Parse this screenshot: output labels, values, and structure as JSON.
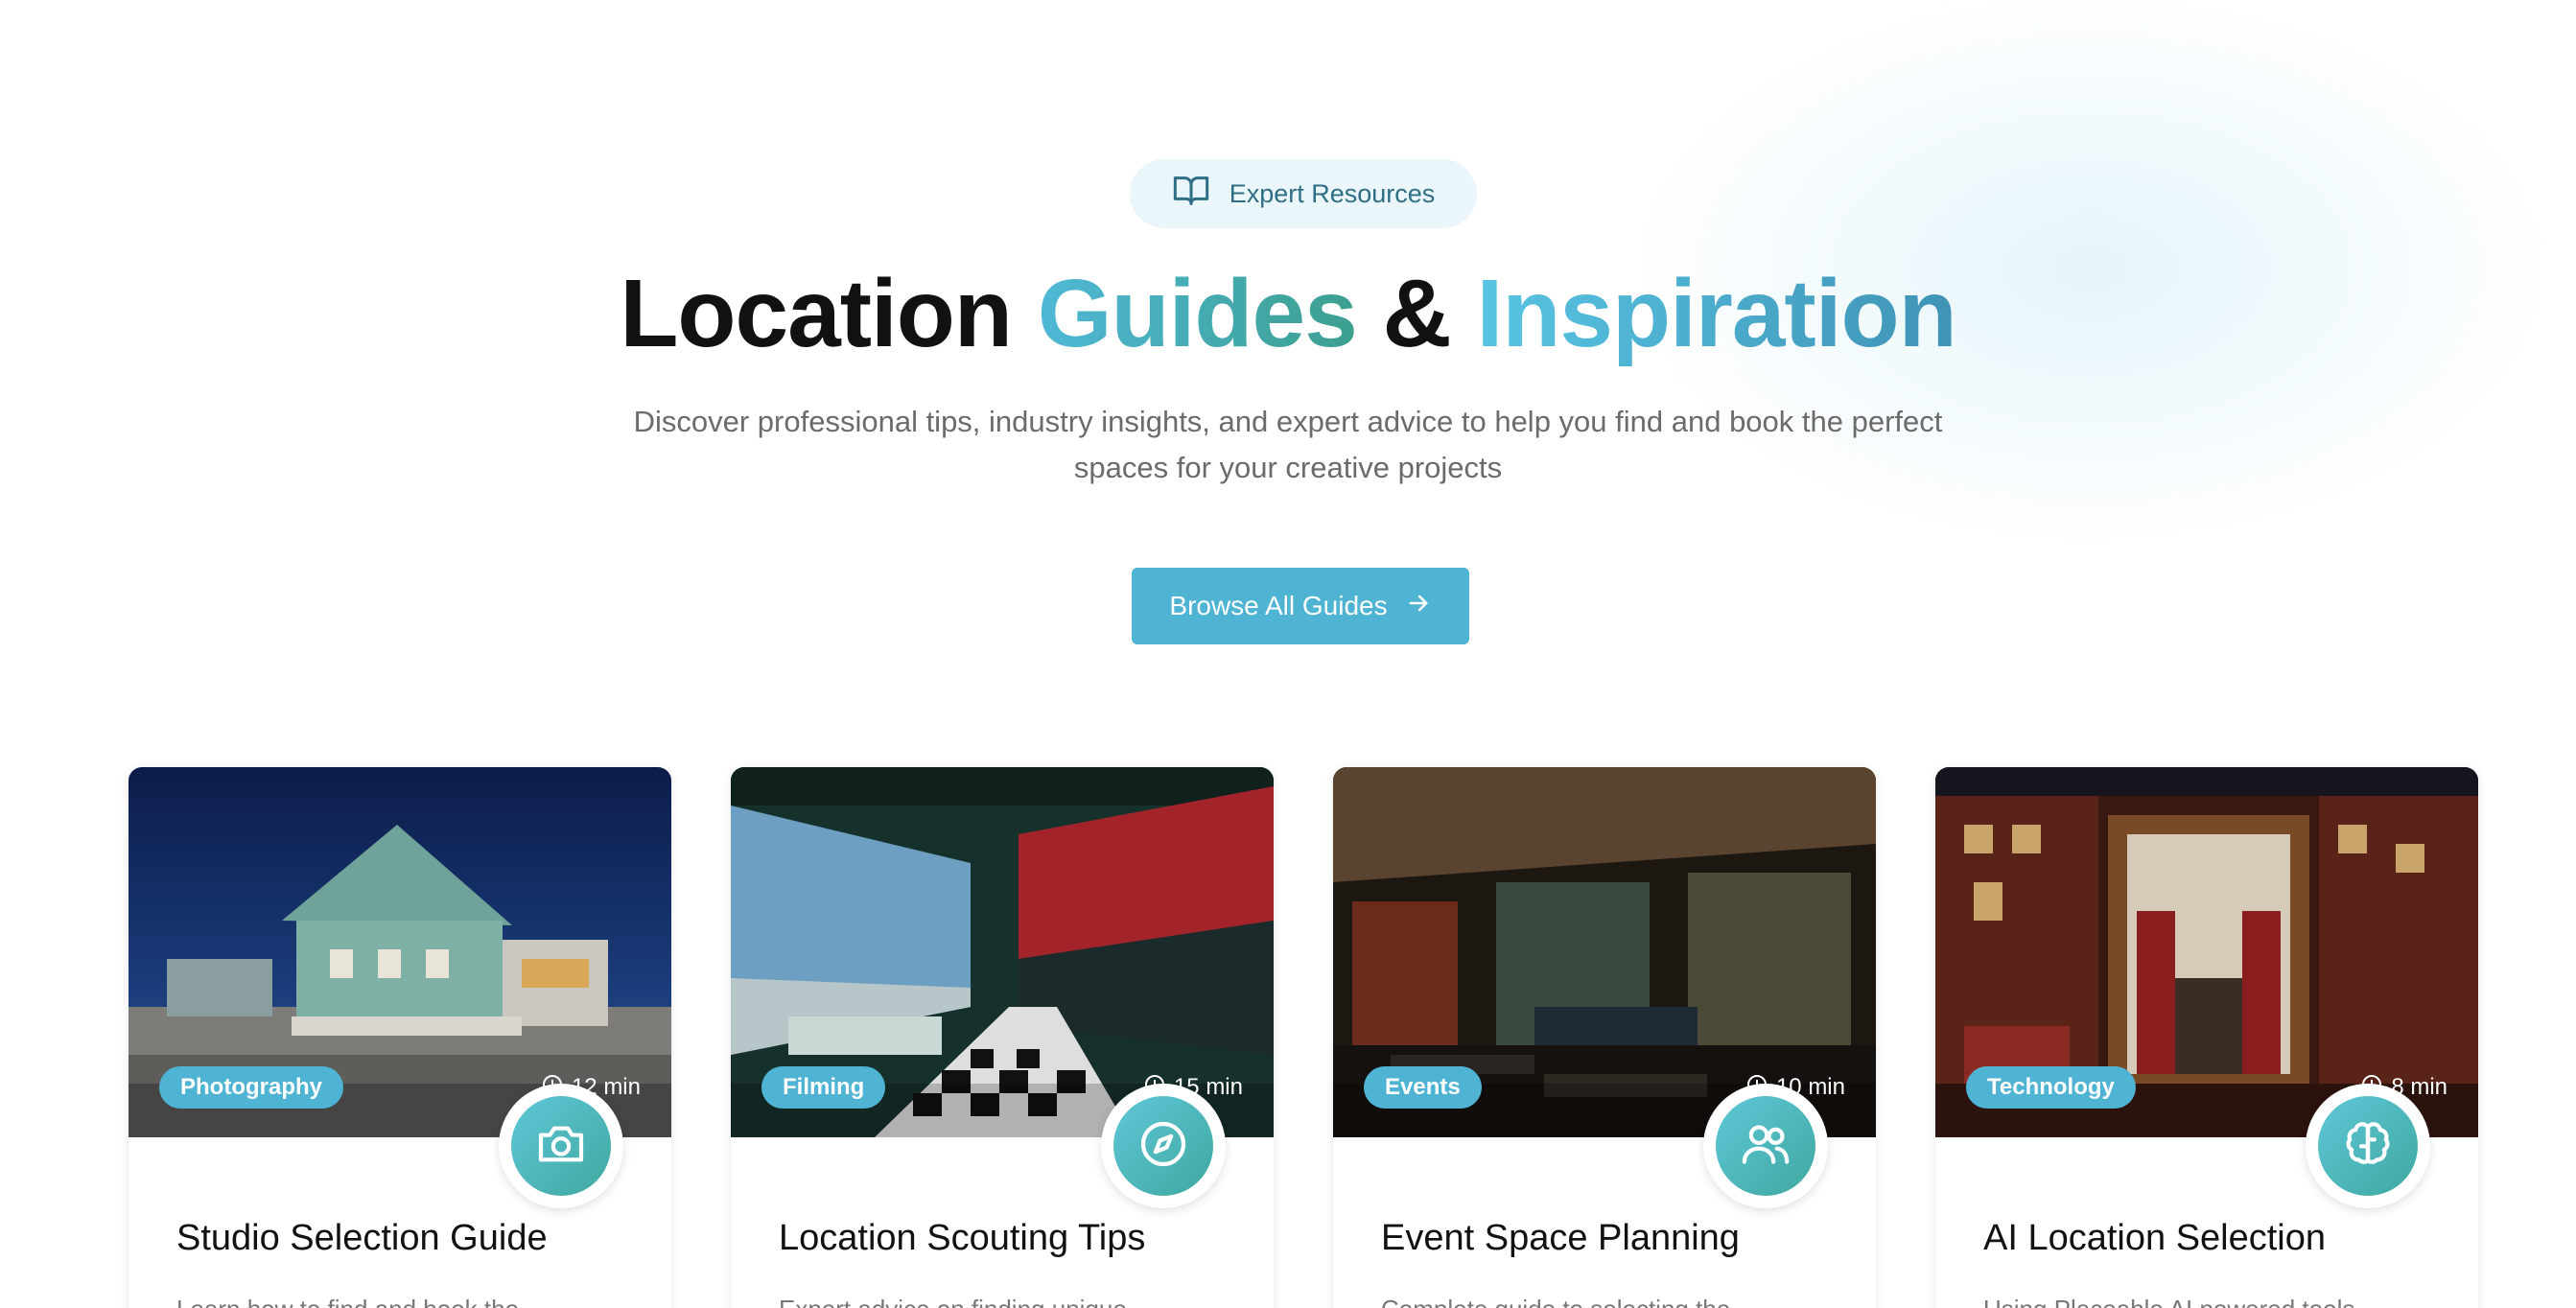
{
  "hero": {
    "badge_label": "Expert Resources",
    "badge_icon": "book-open-icon",
    "title_part1": "Location ",
    "title_part2": "Guides",
    "title_part3": " & ",
    "title_part4": "Inspiration",
    "subtitle_line1": "Discover professional tips, industry insights, and expert advice to help you find and book the perfect",
    "subtitle_line2": "spaces for your creative projects",
    "cta_label": "Browse All Guides",
    "cta_icon": "arrow-right-icon"
  },
  "colors": {
    "accent": "#4fb3d4",
    "accent_teal": "#3fa89f",
    "badge_bg": "#eaf6fa"
  },
  "cards": [
    {
      "category": "Photography",
      "read_time": "12 min",
      "icon": "camera-icon",
      "title": "Studio Selection Guide",
      "desc": "Learn how to find and book the"
    },
    {
      "category": "Filming",
      "read_time": "15 min",
      "icon": "compass-icon",
      "title": "Location Scouting Tips",
      "desc": "Expert advice on finding unique"
    },
    {
      "category": "Events",
      "read_time": "10 min",
      "icon": "users-icon",
      "title": "Event Space Planning",
      "desc": "Complete guide to selecting the"
    },
    {
      "category": "Technology",
      "read_time": "8 min",
      "icon": "brain-icon",
      "title": "AI Location Selection",
      "desc": "Using Placeable AI powered tools"
    }
  ]
}
